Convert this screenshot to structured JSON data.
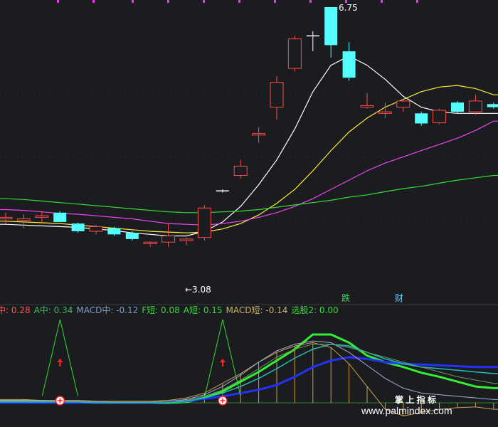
{
  "chart_data": [
    {
      "type": "candlestick",
      "annotations": {
        "high_label": "6.75",
        "low_label": "←3.08",
        "signal_die": "跌",
        "signal_cai": "财"
      },
      "candles": [
        {
          "o": 4.02,
          "h": 4.1,
          "l": 3.95,
          "c": 4.04,
          "dir": "up"
        },
        {
          "o": 4.0,
          "h": 4.08,
          "l": 3.9,
          "c": 4.02,
          "dir": "up"
        },
        {
          "o": 4.04,
          "h": 4.12,
          "l": 3.96,
          "c": 4.06,
          "dir": "up"
        },
        {
          "o": 4.1,
          "h": 4.12,
          "l": 3.98,
          "c": 3.98,
          "dir": "down"
        },
        {
          "o": 3.96,
          "h": 3.97,
          "l": 3.84,
          "c": 3.86,
          "dir": "down"
        },
        {
          "o": 3.92,
          "h": 3.94,
          "l": 3.82,
          "c": 3.86,
          "dir": "up"
        },
        {
          "o": 3.9,
          "h": 3.92,
          "l": 3.8,
          "c": 3.82,
          "dir": "down"
        },
        {
          "o": 3.84,
          "h": 3.86,
          "l": 3.74,
          "c": 3.76,
          "dir": "down"
        },
        {
          "o": 3.7,
          "h": 3.73,
          "l": 3.66,
          "c": 3.72,
          "dir": "up"
        },
        {
          "o": 3.72,
          "h": 3.96,
          "l": 3.66,
          "c": 3.8,
          "dir": "up"
        },
        {
          "o": 3.74,
          "h": 3.78,
          "l": 3.68,
          "c": 3.76,
          "dir": "up"
        },
        {
          "o": 3.78,
          "h": 4.2,
          "l": 3.74,
          "c": 4.16,
          "dir": "up"
        },
        {
          "o": 4.38,
          "h": 4.4,
          "l": 4.36,
          "c": 4.38,
          "dir": "flat"
        },
        {
          "o": 4.58,
          "h": 4.78,
          "l": 4.54,
          "c": 4.7,
          "dir": "up"
        },
        {
          "o": 5.1,
          "h": 5.2,
          "l": 5.0,
          "c": 5.12,
          "dir": "up"
        },
        {
          "o": 5.46,
          "h": 5.86,
          "l": 5.3,
          "c": 5.78,
          "dir": "up"
        },
        {
          "o": 5.96,
          "h": 6.38,
          "l": 5.92,
          "c": 6.34,
          "dir": "up"
        },
        {
          "o": 6.38,
          "h": 6.44,
          "l": 6.18,
          "c": 6.38,
          "dir": "flat"
        },
        {
          "o": 6.26,
          "h": 6.75,
          "l": 6.1,
          "c": 6.75,
          "dir": "down"
        },
        {
          "o": 6.18,
          "h": 6.3,
          "l": 5.8,
          "c": 5.84,
          "dir": "down"
        },
        {
          "o": 5.46,
          "h": 5.64,
          "l": 5.44,
          "c": 5.48,
          "dir": "up"
        },
        {
          "o": 5.38,
          "h": 5.52,
          "l": 5.32,
          "c": 5.4,
          "dir": "up"
        },
        {
          "o": 5.46,
          "h": 5.56,
          "l": 5.4,
          "c": 5.54,
          "dir": "up"
        },
        {
          "o": 5.38,
          "h": 5.4,
          "l": 5.22,
          "c": 5.25,
          "dir": "down"
        },
        {
          "o": 5.26,
          "h": 5.44,
          "l": 5.24,
          "c": 5.42,
          "dir": "up"
        },
        {
          "o": 5.52,
          "h": 5.54,
          "l": 5.38,
          "c": 5.4,
          "dir": "down"
        },
        {
          "o": 5.4,
          "h": 5.62,
          "l": 5.36,
          "c": 5.54,
          "dir": "up"
        },
        {
          "o": 5.5,
          "h": 5.52,
          "l": 5.44,
          "c": 5.46,
          "dir": "down"
        }
      ],
      "ma_lines": [
        {
          "color": "#ffffff",
          "values": [
            3.95,
            3.94,
            3.93,
            3.92,
            3.91,
            3.89,
            3.87,
            3.84,
            3.82,
            3.8,
            3.8,
            3.86,
            3.98,
            4.18,
            4.46,
            4.78,
            5.18,
            5.66,
            6.0,
            6.12,
            6.0,
            5.82,
            5.6,
            5.46,
            5.4,
            5.38,
            5.38,
            5.38
          ]
        },
        {
          "color": "#ffee33",
          "values": [
            3.99,
            3.98,
            3.97,
            3.96,
            3.94,
            3.92,
            3.9,
            3.88,
            3.86,
            3.85,
            3.84,
            3.85,
            3.89,
            3.96,
            4.07,
            4.22,
            4.4,
            4.64,
            4.9,
            5.14,
            5.32,
            5.46,
            5.56,
            5.66,
            5.72,
            5.74,
            5.7,
            5.62
          ]
        },
        {
          "color": "#ee44ee",
          "values": [
            4.14,
            4.13,
            4.11,
            4.09,
            4.08,
            4.06,
            4.04,
            4.02,
            3.99,
            3.96,
            3.95,
            3.94,
            3.96,
            3.99,
            4.04,
            4.1,
            4.18,
            4.28,
            4.4,
            4.52,
            4.64,
            4.74,
            4.82,
            4.9,
            4.98,
            5.06,
            5.16,
            5.28
          ]
        },
        {
          "color": "#33dd33",
          "values": [
            4.28,
            4.27,
            4.25,
            4.23,
            4.21,
            4.19,
            4.17,
            4.15,
            4.13,
            4.11,
            4.1,
            4.1,
            4.11,
            4.12,
            4.14,
            4.17,
            4.2,
            4.23,
            4.26,
            4.3,
            4.33,
            4.37,
            4.41,
            4.44,
            4.48,
            4.52,
            4.55,
            4.58
          ]
        }
      ]
    },
    {
      "type": "line",
      "legend": [
        {
          "text": "中: 0.28",
          "color": "#ff5555"
        },
        {
          "text": "A中: 0.34",
          "color": "#33bb55"
        },
        {
          "text": "MACD中: -0.12",
          "color": "#7e9bcc"
        },
        {
          "text": "F短: 0.08",
          "color": "#33dd33"
        },
        {
          "text": "A短: 0.15",
          "color": "#33dd33"
        },
        {
          "text": "MACD短: -0.14",
          "color": "#d0b060"
        },
        {
          "text": "选股2: 0.00",
          "color": "#33dd33"
        }
      ],
      "series": [
        {
          "color": "#33ee33",
          "width": 3,
          "values": [
            0.02,
            0.02,
            0.02,
            0.01,
            0.01,
            0.0,
            0.0,
            0.0,
            0.0,
            0.0,
            0.01,
            0.06,
            0.14,
            0.26,
            0.38,
            0.52,
            0.66,
            0.84,
            0.84,
            0.74,
            0.58,
            0.5,
            0.44,
            0.37,
            0.32,
            0.26,
            0.2,
            0.18
          ]
        },
        {
          "color": "#2233ff",
          "width": 3,
          "values": [
            0.0,
            0.0,
            0.0,
            0.0,
            0.0,
            0.0,
            0.0,
            0.0,
            0.0,
            0.01,
            0.02,
            0.05,
            0.08,
            0.12,
            0.16,
            0.22,
            0.32,
            0.44,
            0.52,
            0.56,
            0.54,
            0.5,
            0.48,
            0.47,
            0.46,
            0.45,
            0.44,
            0.44
          ]
        },
        {
          "color": "#22bbbb",
          "width": 1.5,
          "values": [
            0.01,
            0.01,
            0.01,
            0.01,
            0.01,
            0.0,
            0.0,
            0.0,
            0.0,
            0.0,
            0.02,
            0.06,
            0.12,
            0.2,
            0.3,
            0.42,
            0.55,
            0.66,
            0.72,
            0.7,
            0.62,
            0.54,
            0.48,
            0.44,
            0.42,
            0.4,
            0.38,
            0.36
          ]
        },
        {
          "color": "#c8a050",
          "width": 1,
          "values": [
            0.04,
            0.04,
            0.03,
            0.03,
            0.03,
            0.02,
            0.02,
            0.02,
            0.02,
            0.03,
            0.06,
            0.12,
            0.24,
            0.36,
            0.5,
            0.62,
            0.7,
            0.74,
            0.68,
            0.48,
            0.2,
            -0.08,
            -0.16,
            -0.12,
            -0.08,
            -0.06,
            -0.05,
            -0.08
          ]
        },
        {
          "color": "#aaaadd",
          "width": 1,
          "values": [
            0.03,
            0.03,
            0.03,
            0.02,
            0.02,
            0.02,
            0.01,
            0.01,
            0.01,
            0.02,
            0.04,
            0.1,
            0.2,
            0.34,
            0.5,
            0.64,
            0.72,
            0.76,
            0.74,
            0.62,
            0.46,
            0.3,
            0.18,
            0.12,
            0.1,
            0.08,
            0.06,
            0.04
          ]
        },
        {
          "color": "#669966",
          "width": 1,
          "values": [
            0.02,
            0.02,
            0.02,
            0.02,
            0.02,
            0.01,
            0.01,
            0.01,
            0.01,
            0.02,
            0.03,
            0.08,
            0.16,
            0.28,
            0.42,
            0.56,
            0.66,
            0.72,
            0.72,
            0.68,
            0.62,
            0.56,
            0.5,
            0.44,
            0.38,
            0.32,
            0.28,
            0.24
          ]
        }
      ],
      "signals": [
        {
          "index": 1
        },
        {
          "index": 10
        }
      ],
      "watermark": {
        "line1": "掌 上 指 标",
        "line2": "www.palmindex.com"
      }
    }
  ]
}
